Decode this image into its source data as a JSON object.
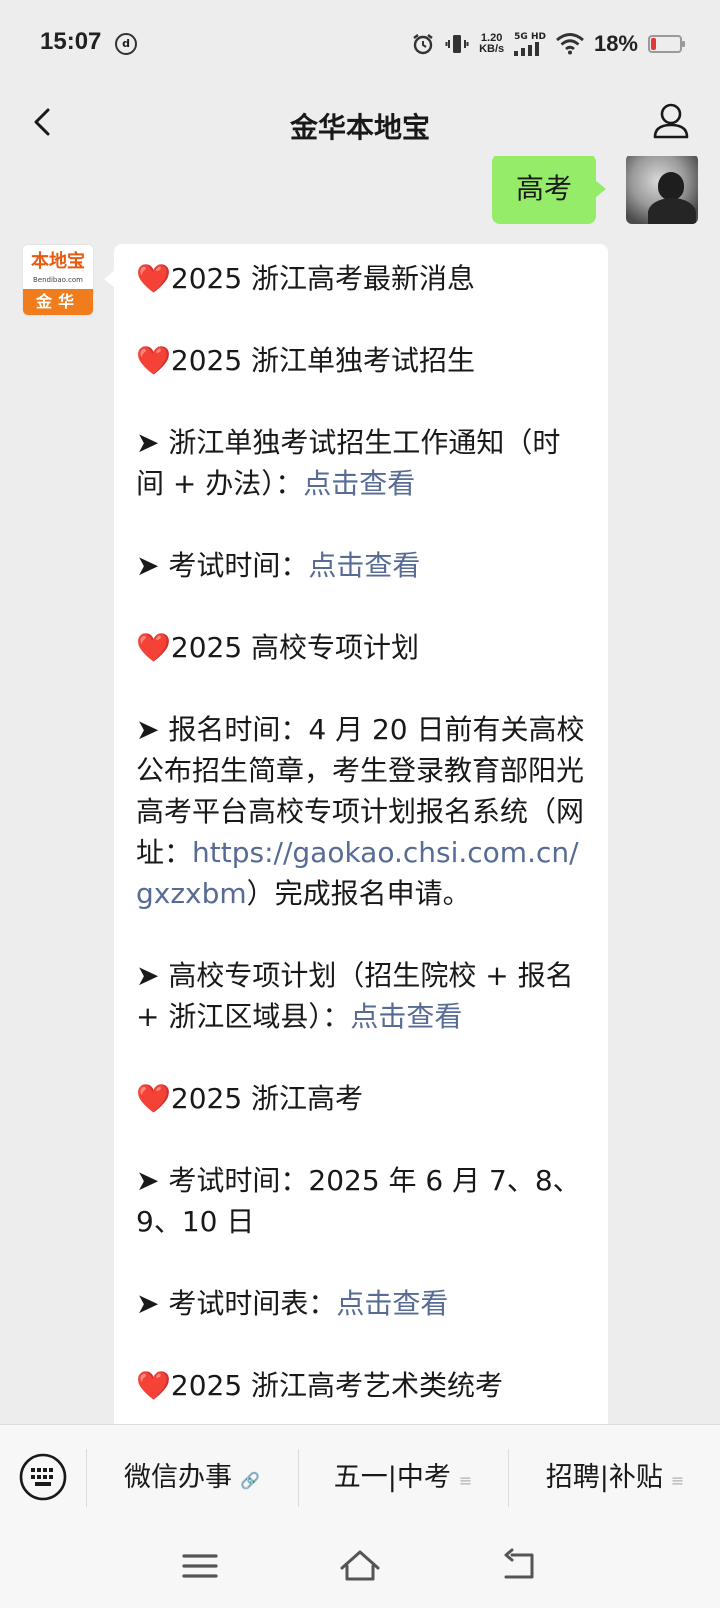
{
  "status_bar": {
    "time": "15:07",
    "dnd_symbol": "d",
    "speed_value": "1.20",
    "speed_unit": "KB/s",
    "network_label": "5G HD",
    "battery_percent": "18%",
    "battery_level": 0.18,
    "battery_color": "#e53935"
  },
  "nav": {
    "title": "金华本地宝",
    "back_icon": "chevron-left-icon",
    "profile_icon": "person-icon"
  },
  "chat": {
    "user_message": "高考",
    "bot_avatar": {
      "logo_name": "本地宝",
      "logo_url": "Bendibao.com",
      "logo_city": "金华"
    },
    "bot_message": [
      {
        "type": "heart",
        "segments": [
          {
            "text": "2025 浙江高考最新消息"
          }
        ]
      },
      {
        "type": "heart",
        "segments": [
          {
            "text": "2025 浙江单独考试招生"
          }
        ]
      },
      {
        "type": "arrow",
        "segments": [
          {
            "text": "浙江单独考试招生工作通知（时间 + 办法）："
          },
          {
            "text": "点击查看",
            "link": true
          }
        ]
      },
      {
        "type": "arrow",
        "segments": [
          {
            "text": "考试时间："
          },
          {
            "text": "点击查看",
            "link": true
          }
        ]
      },
      {
        "type": "heart",
        "segments": [
          {
            "text": "2025 高校专项计划"
          }
        ]
      },
      {
        "type": "arrow",
        "segments": [
          {
            "text": "报名时间：4 月 20 日前有关高校公布招生简章，考生登录教育部阳光高考平台高校专项计划报名系统（网址："
          },
          {
            "text": "https://gaokao.chsi.com.cn/gxzxbm",
            "link": true
          },
          {
            "text": "）完成报名申请。"
          }
        ]
      },
      {
        "type": "arrow",
        "segments": [
          {
            "text": "高校专项计划（招生院校 + 报名+ 浙江区域县）："
          },
          {
            "text": "点击查看",
            "link": true
          }
        ]
      },
      {
        "type": "heart",
        "segments": [
          {
            "text": "2025 浙江高考"
          }
        ]
      },
      {
        "type": "arrow",
        "segments": [
          {
            "text": "考试时间：2025 年 6 月 7、8、9、10 日"
          }
        ]
      },
      {
        "type": "arrow",
        "segments": [
          {
            "text": "考试时间表："
          },
          {
            "text": "点击查看",
            "link": true
          }
        ]
      },
      {
        "type": "heart",
        "segments": [
          {
            "text": "2025 浙江高考艺术类统考"
          }
        ]
      }
    ],
    "heart_glyph": "❤️",
    "arrow_glyph": "➤ ",
    "link_color": "#576b95",
    "user_bubble_color": "#95ec69"
  },
  "menu": {
    "keyboard_icon": "keyboard-icon",
    "items": [
      {
        "label": "微信办事",
        "suffix_icon": "link-icon"
      },
      {
        "label": "五一|中考",
        "suffix_icon": "menu-lines-icon"
      },
      {
        "label": "招聘|补贴",
        "suffix_icon": "menu-lines-icon"
      }
    ]
  },
  "system_nav": {
    "buttons": [
      "recents-icon",
      "home-icon",
      "back-icon"
    ]
  }
}
